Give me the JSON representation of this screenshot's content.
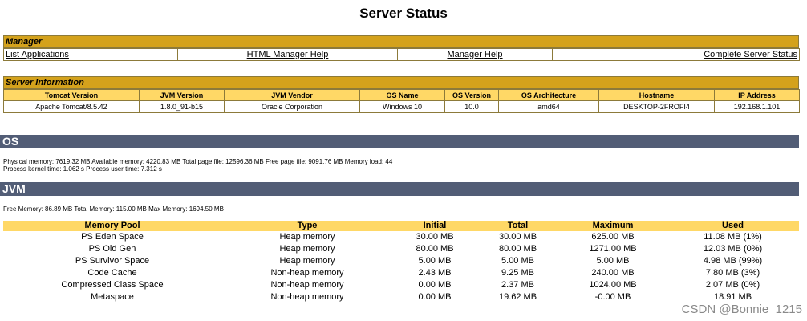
{
  "page_title": "Server Status",
  "manager": {
    "header": "Manager",
    "links": [
      "List Applications",
      "HTML Manager Help",
      "Manager Help",
      "Complete Server Status"
    ]
  },
  "server_info": {
    "header": "Server Information",
    "columns": [
      "Tomcat Version",
      "JVM Version",
      "JVM Vendor",
      "OS Name",
      "OS Version",
      "OS Architecture",
      "Hostname",
      "IP Address"
    ],
    "values": [
      "Apache Tomcat/8.5.42",
      "1.8.0_91-b15",
      "Oracle Corporation",
      "Windows 10",
      "10.0",
      "amd64",
      "DESKTOP-2FROFI4",
      "192.168.1.101"
    ]
  },
  "os": {
    "title": "OS",
    "line1": "Physical memory: 7619.32 MB Available memory: 4220.83 MB Total page file: 12596.36 MB Free page file: 9091.76 MB Memory load: 44",
    "line2": "Process kernel time: 1.062 s Process user time: 7.312 s"
  },
  "jvm": {
    "title": "JVM",
    "summary": "Free Memory: 86.89 MB Total Memory: 115.00 MB Max Memory: 1694.50 MB",
    "pool_columns": [
      "Memory Pool",
      "Type",
      "Initial",
      "Total",
      "Maximum",
      "Used"
    ],
    "pools": [
      [
        "PS Eden Space",
        "Heap memory",
        "30.00 MB",
        "30.00 MB",
        "625.00 MB",
        "11.08 MB (1%)"
      ],
      [
        "PS Old Gen",
        "Heap memory",
        "80.00 MB",
        "80.00 MB",
        "1271.00 MB",
        "12.03 MB (0%)"
      ],
      [
        "PS Survivor Space",
        "Heap memory",
        "5.00 MB",
        "5.00 MB",
        "5.00 MB",
        "4.98 MB (99%)"
      ],
      [
        "Code Cache",
        "Non-heap memory",
        "2.43 MB",
        "9.25 MB",
        "240.00 MB",
        "7.80 MB (3%)"
      ],
      [
        "Compressed Class Space",
        "Non-heap memory",
        "0.00 MB",
        "2.37 MB",
        "1024.00 MB",
        "2.07 MB (0%)"
      ],
      [
        "Metaspace",
        "Non-heap memory",
        "0.00 MB",
        "19.62 MB",
        "-0.00 MB",
        "18.91 MB"
      ]
    ]
  },
  "watermark": "CSDN @Bonnie_1215",
  "colors": {
    "section_header": "#d4a21c",
    "table_header": "#ffd866",
    "bar": "#525d76",
    "border": "#8c7a3a"
  }
}
